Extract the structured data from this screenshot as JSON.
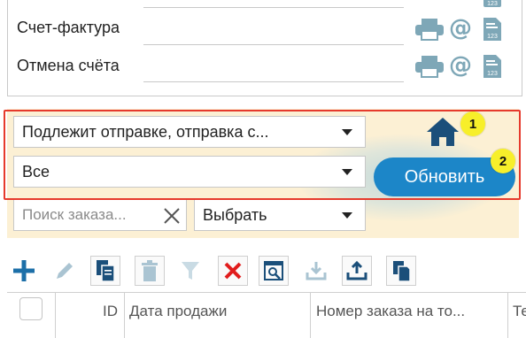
{
  "document_rows": [
    {
      "label": ""
    },
    {
      "label": "Счет-фактура"
    },
    {
      "label": "Отмена счёта"
    }
  ],
  "icons": {
    "printer": "printer-icon",
    "email": "at-email-icon",
    "document": "document-123-icon",
    "home": "home-icon"
  },
  "filters": {
    "status_select": "Подлежит отправке, отправка с...",
    "type_select": "Все",
    "search_placeholder": "Поиск заказа...",
    "choose_select": "Выбрать"
  },
  "refresh_label": "Обновить",
  "annotations": [
    "1",
    "2"
  ],
  "toolbar": [
    "add-icon",
    "edit-icon",
    "copy-icon",
    "delete-icon",
    "filter-icon",
    "clear-filter-icon",
    "preview-icon",
    "import-icon",
    "export-icon",
    "copy-files-icon"
  ],
  "table": {
    "columns": [
      "ID",
      "Дата продажи",
      "Номер заказа на то...",
      "Те"
    ]
  },
  "colors": {
    "highlight": "#e63a2c",
    "accent": "#1c86c8",
    "badge": "#f7ef2a",
    "filter_bg": "#fcf0d4",
    "icon": "#7ea7b7"
  }
}
